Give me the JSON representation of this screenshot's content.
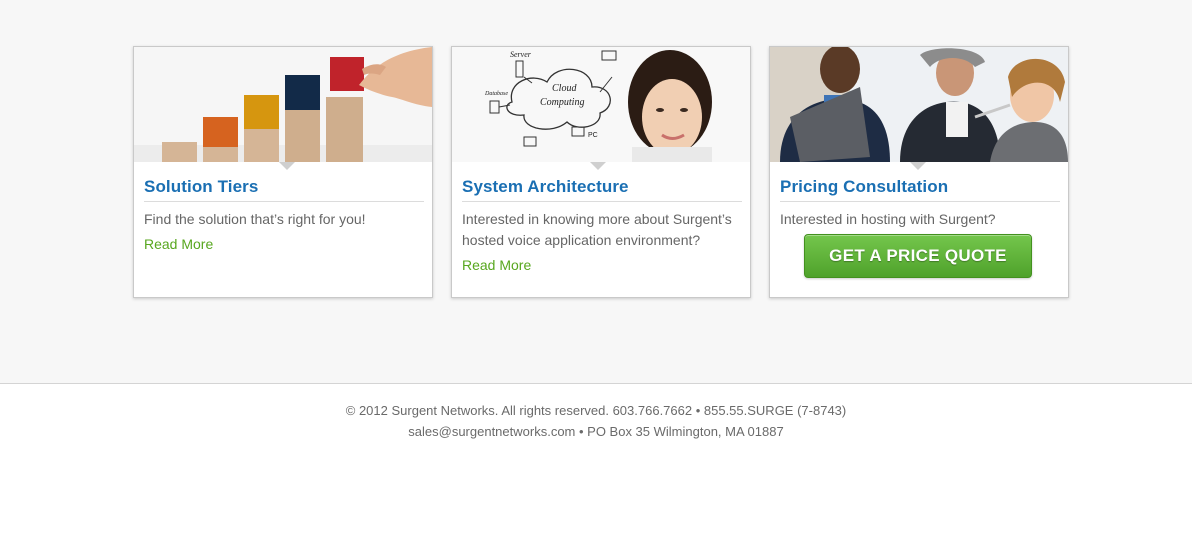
{
  "cards": [
    {
      "title": "Solution Tiers",
      "description": "Find the solution that’s right for you!",
      "link_label": "Read More",
      "image": "stacked-blocks-growth-image"
    },
    {
      "title": "System Architecture",
      "description": "Interested in knowing more about Surgent’s hosted voice application environment?",
      "link_label": "Read More",
      "image": "cloud-computing-woman-image",
      "diagram_labels": {
        "server": "Server",
        "cloud": "Cloud",
        "computing": "Computing",
        "database": "Database",
        "pc": "PC"
      }
    },
    {
      "title": "Pricing Consultation",
      "description": "Interested in hosting with Surgent?",
      "button_label": "GET A PRICE QUOTE",
      "image": "business-meeting-image"
    }
  ],
  "footer": {
    "line1": "© 2012 Surgent Networks. All rights reserved. 603.766.7662 • 855.55.SURGE (7-8743)",
    "line2": "sales@surgentnetworks.com • PO Box 35 Wilmington, MA 01887"
  },
  "colors": {
    "title_blue": "#1a6fb3",
    "link_green": "#58a71f",
    "button_green": "#5cb236",
    "page_bg": "#f7f7f7"
  }
}
